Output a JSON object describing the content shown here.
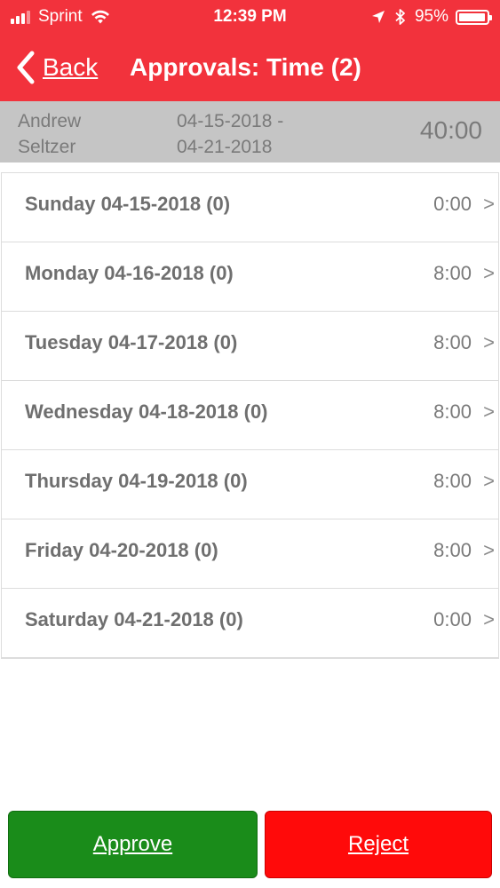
{
  "status_bar": {
    "carrier": "Sprint",
    "time": "12:39 PM",
    "battery": "95%"
  },
  "nav": {
    "back_label": "Back",
    "title": "Approvals: Time (2)"
  },
  "summary": {
    "name_line1": "Andrew",
    "name_line2": "Seltzer",
    "range_line1": "04-15-2018 -",
    "range_line2": "04-21-2018",
    "total": "40:00"
  },
  "days": [
    {
      "label": "Sunday 04-15-2018 (0)",
      "hours": "0:00",
      "chevron": ">"
    },
    {
      "label": "Monday 04-16-2018 (0)",
      "hours": "8:00",
      "chevron": ">"
    },
    {
      "label": "Tuesday 04-17-2018 (0)",
      "hours": "8:00",
      "chevron": ">"
    },
    {
      "label": "Wednesday 04-18-2018 (0)",
      "hours": "8:00",
      "chevron": ">"
    },
    {
      "label": "Thursday 04-19-2018 (0)",
      "hours": "8:00",
      "chevron": ">"
    },
    {
      "label": "Friday 04-20-2018 (0)",
      "hours": "8:00",
      "chevron": ">"
    },
    {
      "label": "Saturday 04-21-2018 (0)",
      "hours": "0:00",
      "chevron": ">"
    }
  ],
  "actions": {
    "approve_label": "Approve",
    "reject_label": "Reject"
  },
  "colors": {
    "header_red": "#f2323c",
    "summary_gray": "#c5c5c5",
    "approve_green": "#1a8c1a",
    "reject_red": "#ff0a0a"
  }
}
